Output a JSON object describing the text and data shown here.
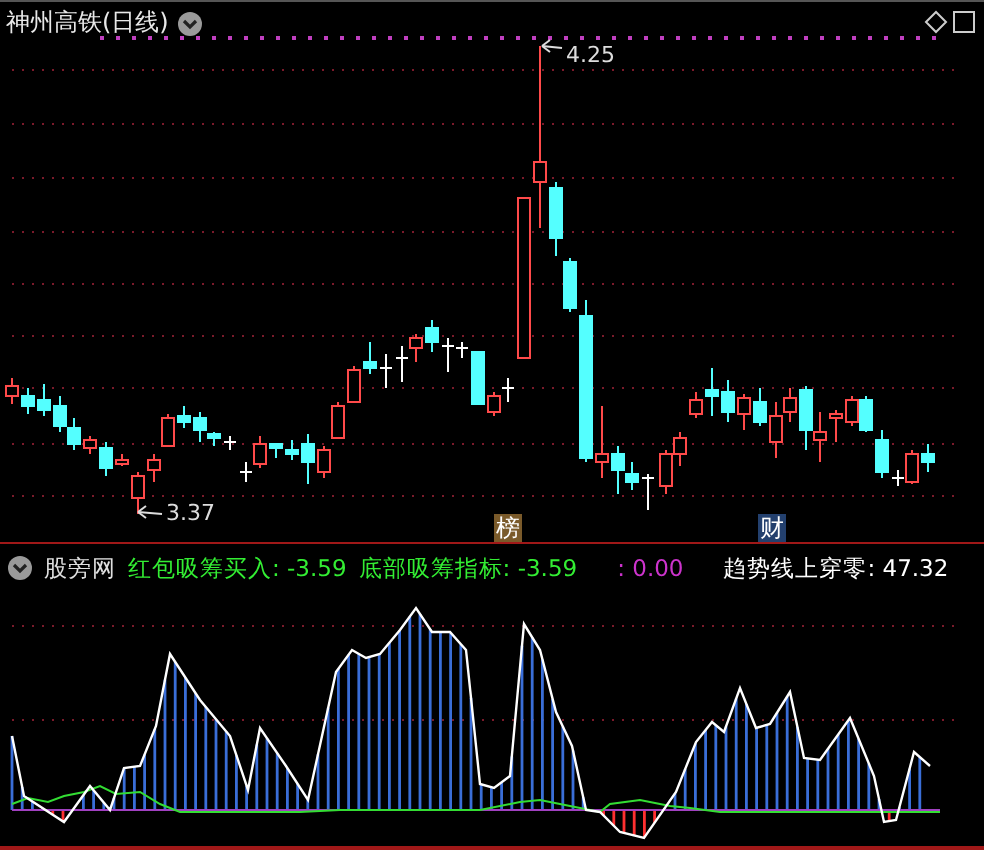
{
  "window": {
    "title": "神州高铁(日线)"
  },
  "price_panel": {
    "annotations": [
      {
        "kind": "high",
        "text": "4.25"
      },
      {
        "kind": "low",
        "text": "3.37"
      }
    ],
    "event_markers": [
      {
        "text": "榜",
        "color": "#7a5a2a"
      },
      {
        "text": "财",
        "color": "#23406e"
      }
    ]
  },
  "indicator_panel": {
    "name": "股旁网",
    "readouts": [
      {
        "text": "红包吸筹买入: -3.59",
        "color": "#33ee33"
      },
      {
        "text": "底部吸筹指标: -3.59",
        "color": "#33ee33"
      },
      {
        "text": ": 0.00",
        "color": "#cc33cc"
      },
      {
        "text": "趋势线上穿零: 47.32",
        "color": "#ffffff"
      }
    ]
  }
}
